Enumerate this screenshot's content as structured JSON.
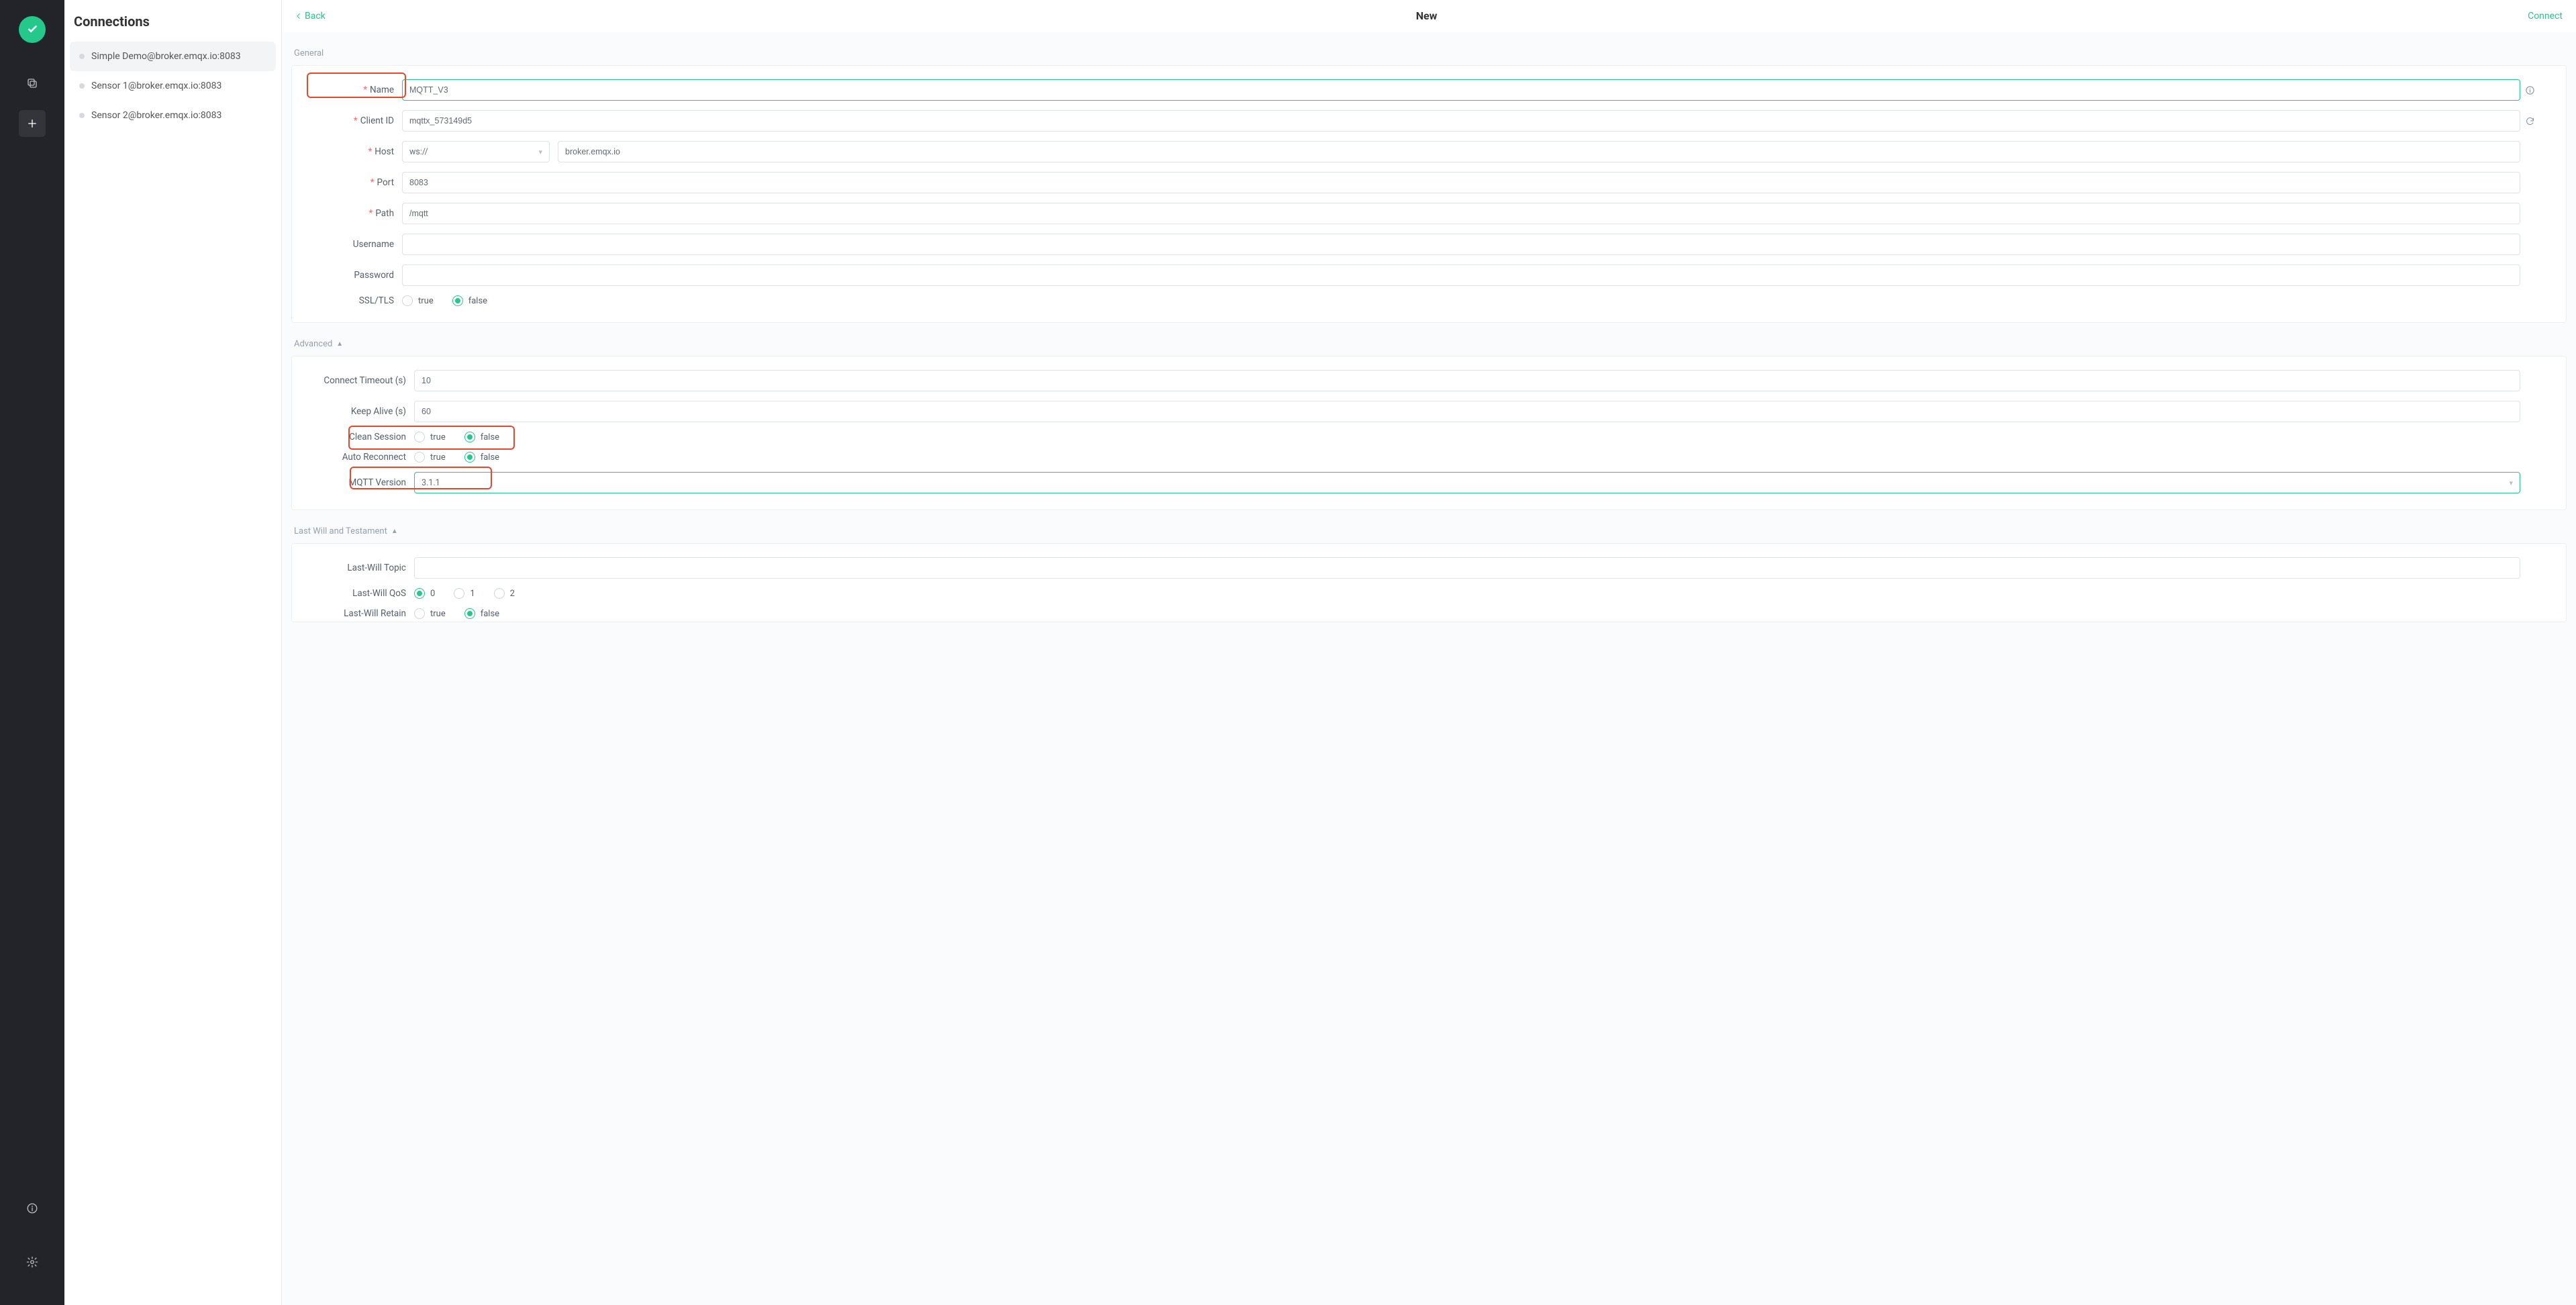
{
  "nav": {
    "logo_title": "MQTTX"
  },
  "sidebar": {
    "title": "Connections",
    "items": [
      {
        "label": "Simple Demo@broker.emqx.io:8083",
        "active": true
      },
      {
        "label": "Sensor 1@broker.emqx.io:8083",
        "active": false
      },
      {
        "label": "Sensor 2@broker.emqx.io:8083",
        "active": false
      }
    ]
  },
  "header": {
    "back": "Back",
    "title": "New",
    "connect": "Connect"
  },
  "sections": {
    "general": "General",
    "advanced": "Advanced",
    "lwt": "Last Will and Testament"
  },
  "general": {
    "name_label": "Name",
    "name_value": "MQTT_V3",
    "client_id_label": "Client ID",
    "client_id_value": "mqttx_573149d5",
    "host_label": "Host",
    "host_scheme": "ws://",
    "host_value": "broker.emqx.io",
    "port_label": "Port",
    "port_value": "8083",
    "path_label": "Path",
    "path_value": "/mqtt",
    "username_label": "Username",
    "username_value": "",
    "password_label": "Password",
    "password_value": "",
    "ssl_label": "SSL/TLS",
    "ssl_value": "false",
    "radio_true": "true",
    "radio_false": "false"
  },
  "advanced": {
    "connect_timeout_label": "Connect Timeout (s)",
    "connect_timeout_value": "10",
    "keep_alive_label": "Keep Alive (s)",
    "keep_alive_value": "60",
    "clean_session_label": "Clean Session",
    "clean_session_value": "false",
    "auto_reconnect_label": "Auto Reconnect",
    "auto_reconnect_value": "false",
    "mqtt_version_label": "MQTT Version",
    "mqtt_version_value": "3.1.1",
    "radio_true": "true",
    "radio_false": "false"
  },
  "lwt": {
    "topic_label": "Last-Will Topic",
    "topic_value": "",
    "qos_label": "Last-Will QoS",
    "qos_value": "0",
    "qos_options": [
      "0",
      "1",
      "2"
    ],
    "retain_label": "Last-Will Retain",
    "retain_value": "false",
    "radio_true": "true",
    "radio_false": "false"
  }
}
